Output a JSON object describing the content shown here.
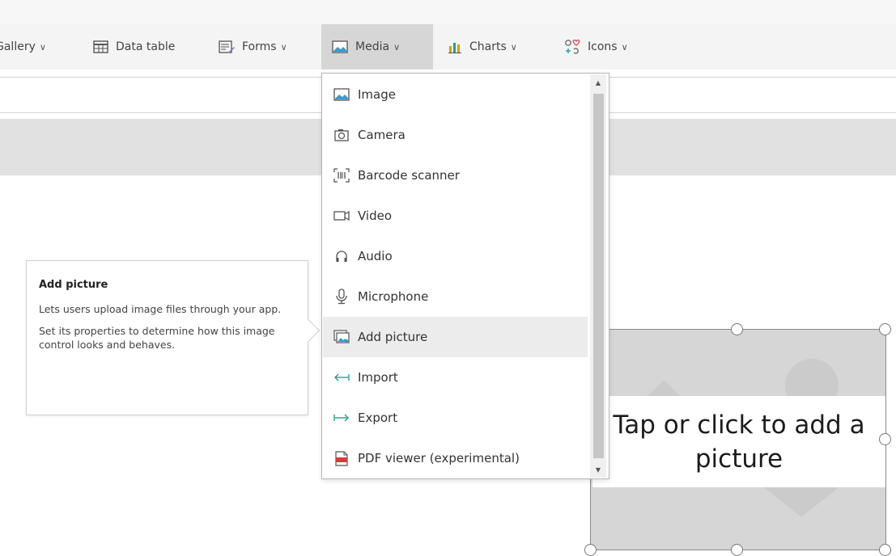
{
  "ribbon": {
    "items": [
      {
        "label": "Gallery",
        "dropdown": true,
        "icon": "gallery-icon"
      },
      {
        "label": "Data table",
        "dropdown": false,
        "icon": "data-table-icon"
      },
      {
        "label": "Forms",
        "dropdown": true,
        "icon": "forms-icon"
      },
      {
        "label": "Media",
        "dropdown": true,
        "icon": "media-icon",
        "active": true
      },
      {
        "label": "Charts",
        "dropdown": true,
        "icon": "charts-icon"
      },
      {
        "label": "Icons",
        "dropdown": true,
        "icon": "icons-icon"
      }
    ],
    "chevron": "∨"
  },
  "media_menu": {
    "items": [
      {
        "label": "Image",
        "icon": "image-icon"
      },
      {
        "label": "Camera",
        "icon": "camera-icon"
      },
      {
        "label": "Barcode scanner",
        "icon": "barcode-icon"
      },
      {
        "label": "Video",
        "icon": "video-icon"
      },
      {
        "label": "Audio",
        "icon": "headphones-icon"
      },
      {
        "label": "Microphone",
        "icon": "microphone-icon"
      },
      {
        "label": "Add picture",
        "icon": "add-picture-icon",
        "highlighted": true
      },
      {
        "label": "Import",
        "icon": "import-arrow-icon"
      },
      {
        "label": "Export",
        "icon": "export-arrow-icon"
      },
      {
        "label": "PDF viewer (experimental)",
        "icon": "pdf-icon"
      }
    ]
  },
  "tooltip": {
    "title": "Add picture",
    "line1": "Lets users upload image files through your app.",
    "line2": "Set its properties to determine how this image control looks and behaves."
  },
  "picture_control": {
    "label": "Tap or click to add a picture"
  },
  "colors": {
    "accent_teal": "#2a9d8f",
    "active_tab_bg": "#d6d6d6",
    "hover_bg": "#ececec"
  }
}
